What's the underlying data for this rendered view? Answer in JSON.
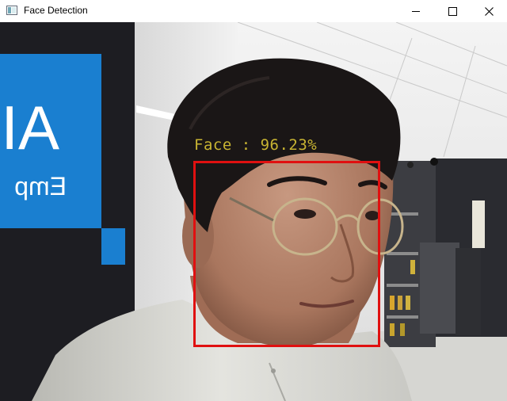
{
  "window": {
    "title": "Face Detection",
    "icons": {
      "app": "app-window-icon",
      "minimize": "minimize-icon",
      "maximize": "maximize-icon",
      "close": "close-icon"
    }
  },
  "sign": {
    "large_text": "AI",
    "small_text": "Emp"
  },
  "detection": {
    "label": "Face : 96.23%",
    "confidence": 96.23,
    "box_color": "#e01010",
    "label_color": "#c8b432"
  },
  "colors": {
    "sign_blue": "#1a7fd0",
    "wall": "#e6e6e6",
    "dark_wall": "#1e1e22"
  }
}
